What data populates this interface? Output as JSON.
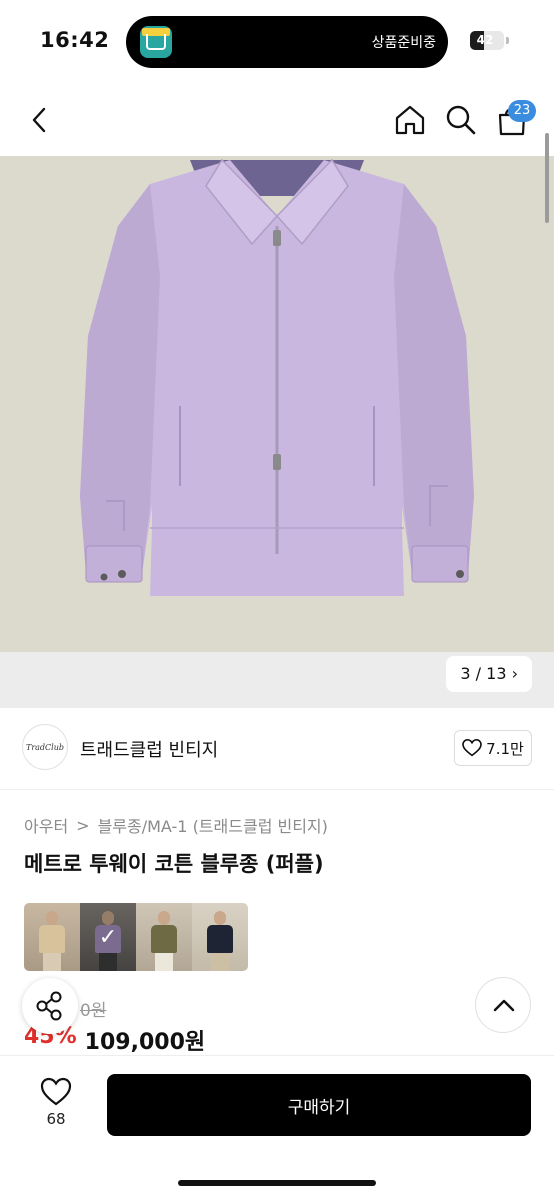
{
  "status_bar": {
    "time": "16:42",
    "activity_text": "상품준비중",
    "battery_level": "42",
    "battery_fraction": 0.42
  },
  "nav": {
    "icons": [
      "back-icon",
      "home-icon",
      "search-icon",
      "shopping-bag-icon"
    ],
    "cart_count": "23"
  },
  "gallery": {
    "counter": "3 / 13",
    "counter_chevron": "›",
    "current_image": 3,
    "total_images": 13
  },
  "brand": {
    "logo_text": "TradClub",
    "name": "트래드클럽 빈티지",
    "likes": "7.1만"
  },
  "product": {
    "breadcrumb": [
      "아우터",
      "블루종/MA-1 (트래드클럽 빈티지)"
    ],
    "breadcrumb_separator": ">",
    "title": "메트로 투웨이 코튼 블루종 (퍼플)",
    "original_price": "0원",
    "discount": "45%",
    "price": "109,000원",
    "color_options_selected_index": 1
  },
  "colors": {
    "accent": "#3a8dde",
    "discount": "#e0302d",
    "buy_button": "#000000",
    "jacket": "#c9b7df"
  },
  "bottom_bar": {
    "like_count": "68",
    "buy_label": "구매하기"
  }
}
